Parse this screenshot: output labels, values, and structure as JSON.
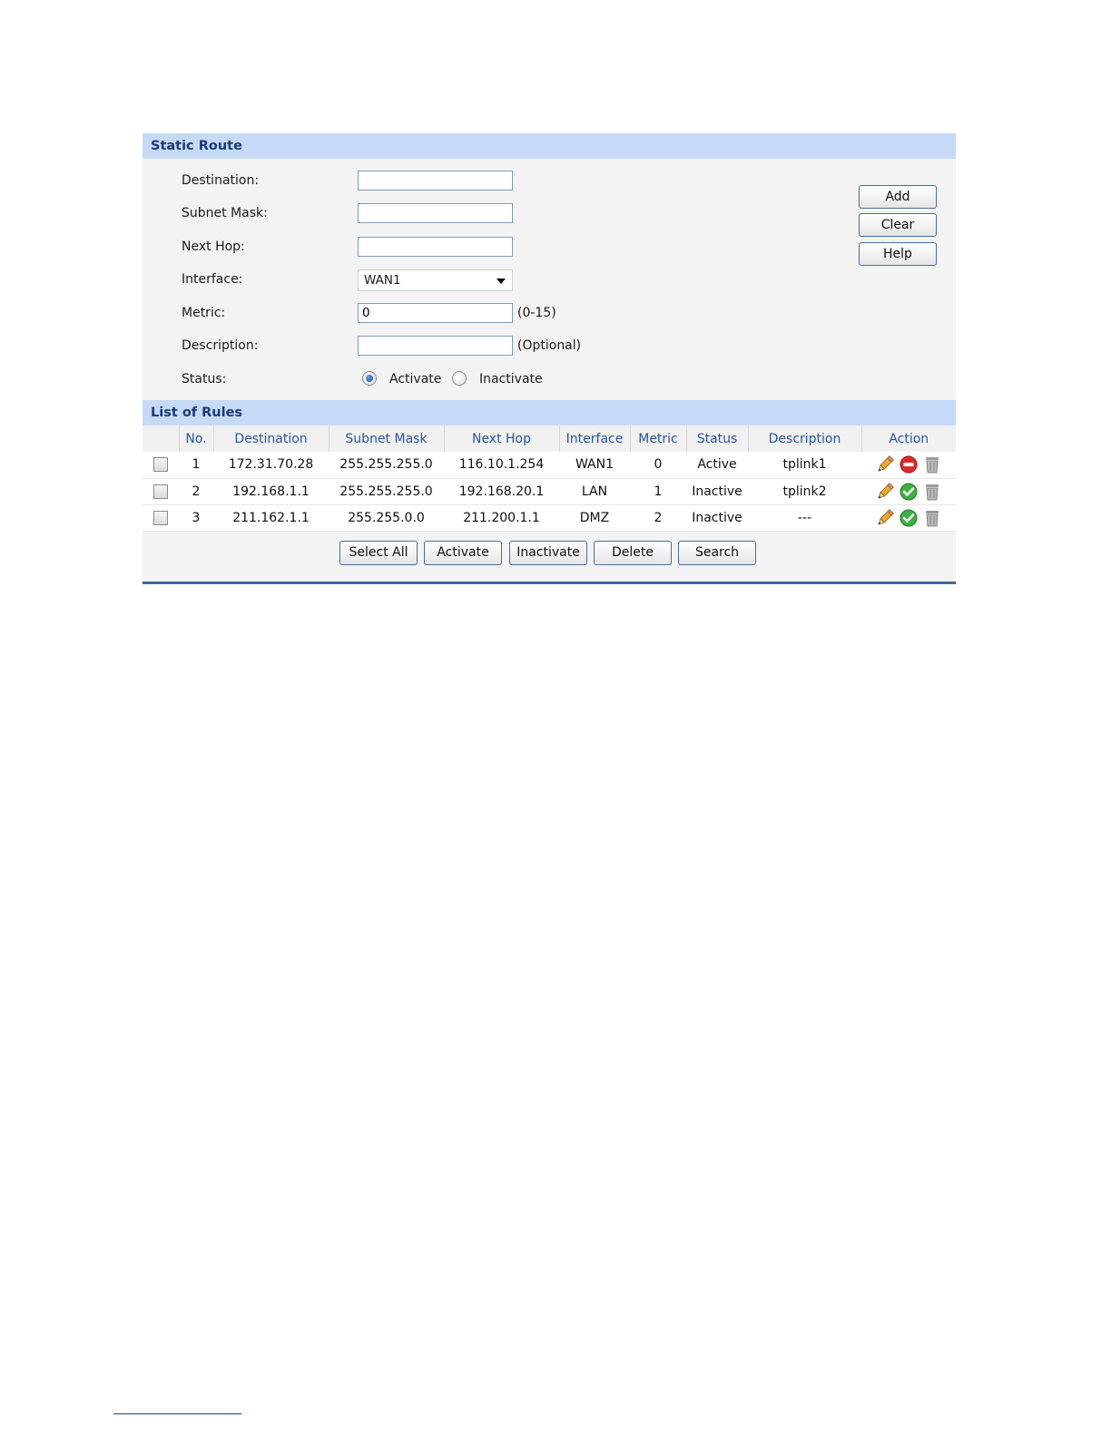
{
  "static_route": {
    "title": "Static Route",
    "fields": {
      "destination": {
        "label": "Destination:",
        "value": ""
      },
      "subnet_mask": {
        "label": "Subnet Mask:",
        "value": ""
      },
      "next_hop": {
        "label": "Next Hop:",
        "value": ""
      },
      "interface": {
        "label": "Interface:",
        "value": "WAN1"
      },
      "metric": {
        "label": "Metric:",
        "value": "0",
        "hint": "(0-15)"
      },
      "description": {
        "label": "Description:",
        "value": "",
        "hint": "(Optional)"
      },
      "status": {
        "label": "Status:",
        "options": [
          "Activate",
          "Inactivate"
        ],
        "selected": "Activate"
      }
    },
    "buttons": {
      "add": "Add",
      "clear": "Clear",
      "help": "Help"
    }
  },
  "rules": {
    "title": "List of Rules",
    "columns": [
      "",
      "No.",
      "Destination",
      "Subnet Mask",
      "Next Hop",
      "Interface",
      "Metric",
      "Status",
      "Description",
      "Action"
    ],
    "rows": [
      {
        "no": "1",
        "destination": "172.31.70.28",
        "subnet_mask": "255.255.255.0",
        "next_hop": "116.10.1.254",
        "interface": "WAN1",
        "metric": "0",
        "status": "Active",
        "description": "tplink1",
        "toggle_icon": "deactivate-icon",
        "checked": false
      },
      {
        "no": "2",
        "destination": "192.168.1.1",
        "subnet_mask": "255.255.255.0",
        "next_hop": "192.168.20.1",
        "interface": "LAN",
        "metric": "1",
        "status": "Inactive",
        "description": "tplink2",
        "toggle_icon": "activate-icon",
        "checked": false
      },
      {
        "no": "3",
        "destination": "211.162.1.1",
        "subnet_mask": "255.255.0.0",
        "next_hop": "211.200.1.1",
        "interface": "DMZ",
        "metric": "2",
        "status": "Inactive",
        "description": "---",
        "toggle_icon": "activate-icon",
        "checked": false
      }
    ],
    "buttons": {
      "select_all": "Select All",
      "activate": "Activate",
      "inactivate": "Inactivate",
      "delete": "Delete",
      "search": "Search"
    }
  },
  "colors": {
    "header_bg": "#c6daf7",
    "header_text": "#1a3a78",
    "column_text": "#2855a0",
    "panel_bg": "#f3f3f3",
    "border_accent": "#3e6b97"
  }
}
